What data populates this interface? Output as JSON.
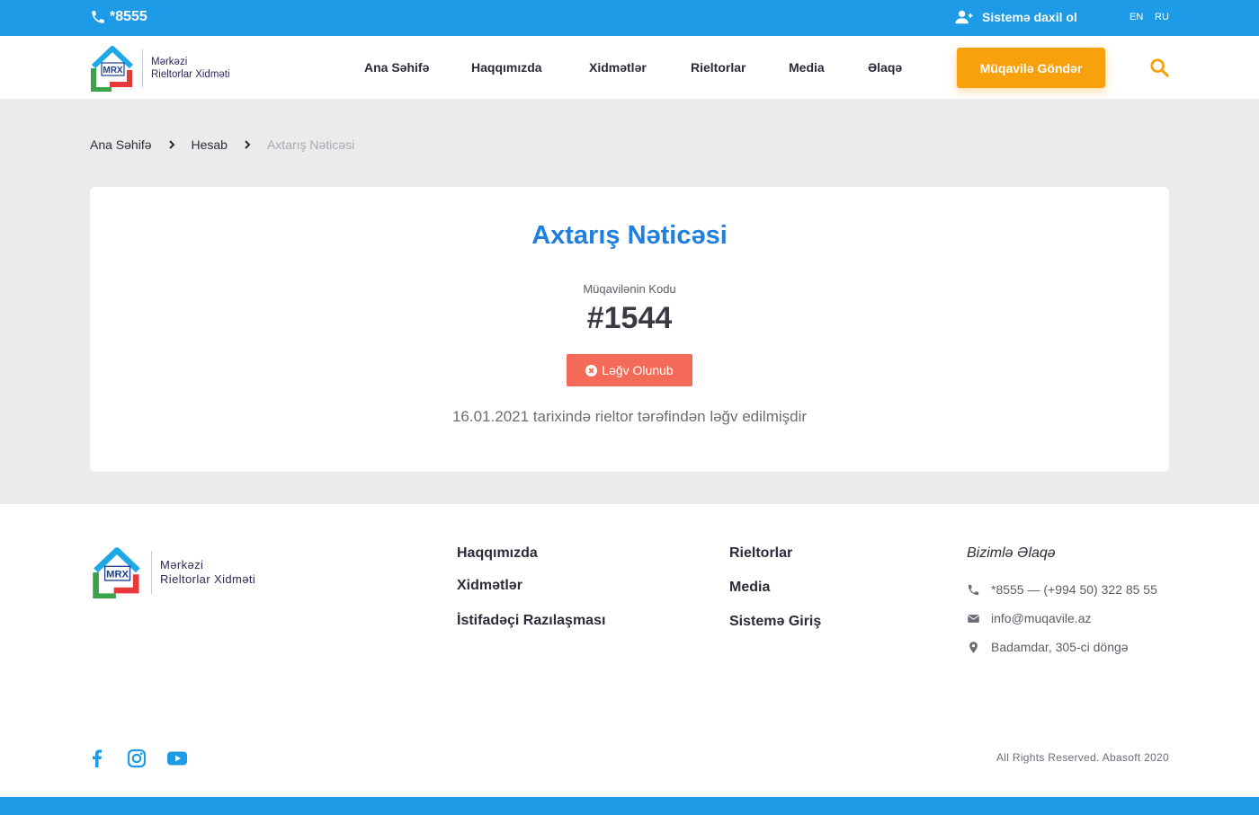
{
  "topbar": {
    "phone": "*8555",
    "login_label": "Sistemə daxil ol",
    "languages": [
      "EN",
      "RU"
    ]
  },
  "header": {
    "logo": {
      "line1": "Mərkəzi",
      "line2": "Rieltorlar Xidməti",
      "mark": "MRX"
    },
    "nav": [
      "Ana Səhifə",
      "Haqqımızda",
      "Xidmətlər",
      "Rieltorlar",
      "Media",
      "Əlaqə"
    ],
    "cta_label": "Müqavilə Göndər"
  },
  "breadcrumb": [
    "Ana Səhifə",
    "Hesab",
    "Axtarış Nəticəsi"
  ],
  "result": {
    "title": "Axtarış Nəticəsi",
    "code_label": "Müqavilənin Kodu",
    "code": "#1544",
    "status": "Ləğv Olunub",
    "note": "16.01.2021 tarixində rieltor tərəfindən ləğv edilmişdir"
  },
  "footer": {
    "logo": {
      "line1": "Mərkəzi",
      "line2": "Rieltorlar Xidməti",
      "mark": "MRX"
    },
    "links_col1": [
      "Haqqımızda",
      "Xidmətlər",
      "İstifadəçi Razılaşması"
    ],
    "links_col2": [
      "Rieltorlar",
      "Media",
      "Sistemə Giriş"
    ],
    "contact_title": "Bizimlə Əlaqə",
    "contacts": {
      "phone": "*8555 — (+994 50) 322 85 55",
      "email": "info@muqavile.az",
      "address": "Badamdar, 305-ci döngə"
    },
    "copyright": "All Rights Reserved. Abasoft 2020"
  },
  "colors": {
    "primary_blue": "#1e9be6",
    "title_blue": "#1e7fe0",
    "cta_orange": "#f8a10d",
    "cancel_red": "#f36b58"
  }
}
